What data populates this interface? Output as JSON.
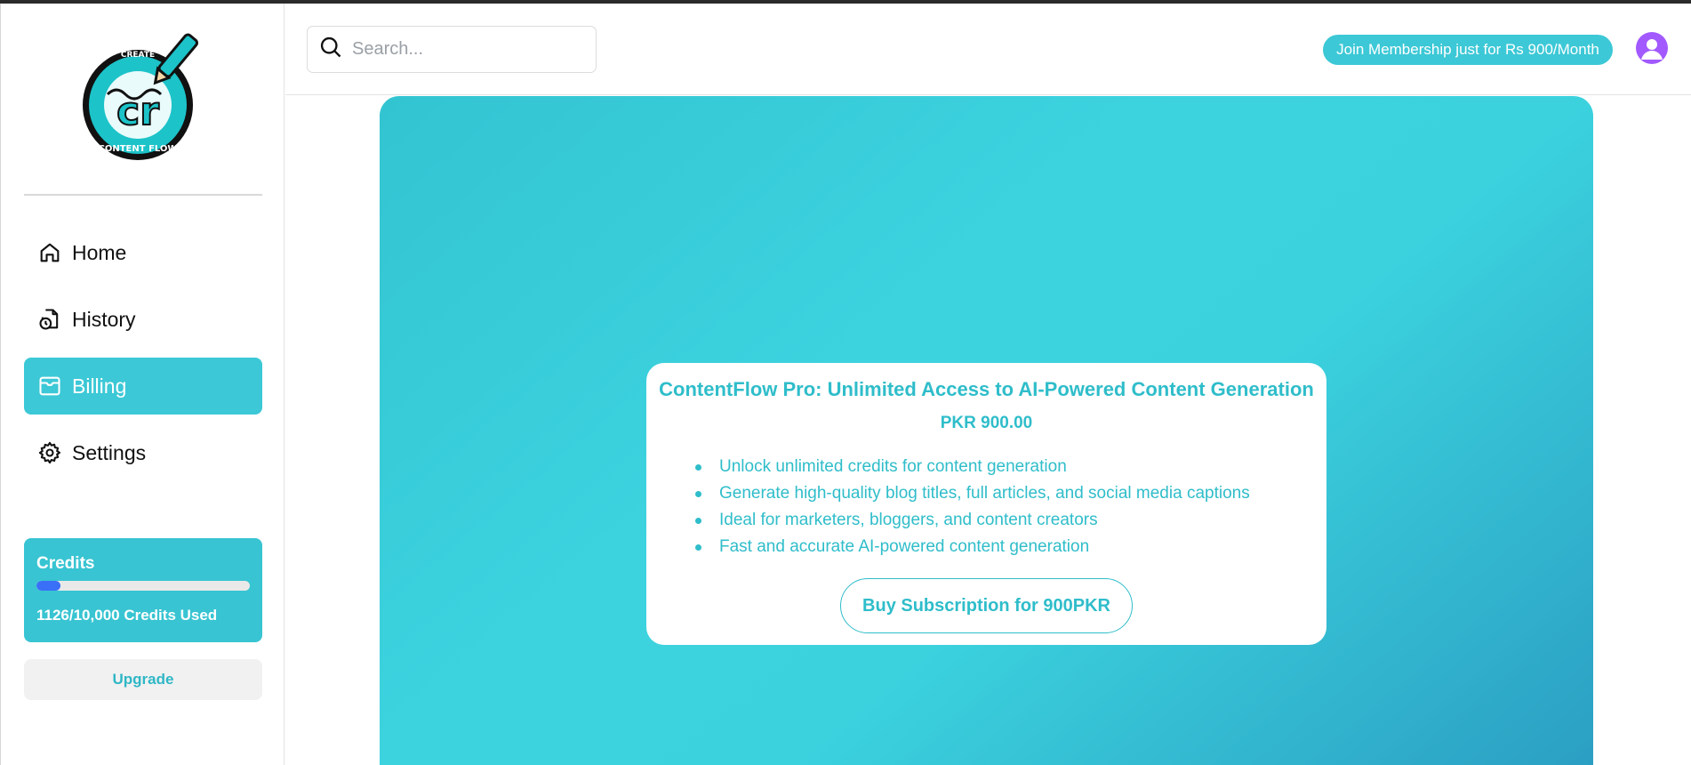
{
  "app": {
    "name": "ContentFlow",
    "logo_text_top": "CREATE",
    "logo_text_bottom": "CONTENT FLOW",
    "logo_monogram": "cr"
  },
  "sidebar": {
    "items": [
      {
        "label": "Home",
        "icon": "home-icon",
        "active": false
      },
      {
        "label": "History",
        "icon": "history-icon",
        "active": false
      },
      {
        "label": "Billing",
        "icon": "billing-icon",
        "active": true
      },
      {
        "label": "Settings",
        "icon": "gear-icon",
        "active": false
      }
    ],
    "credits": {
      "title": "Credits",
      "used": 1126,
      "total": 10000,
      "fraction_used": 0.1126,
      "text": "1126/10,000 Credits Used"
    },
    "upgrade_label": "Upgrade"
  },
  "header": {
    "search_placeholder": "Search...",
    "membership_label": "Join Membership just for Rs 900/Month"
  },
  "plan": {
    "title": "ContentFlow Pro: Unlimited Access to AI-Powered Content Generation",
    "price": "PKR 900.00",
    "features": [
      "Unlock unlimited credits for content generation",
      "Generate high-quality blog titles, full articles, and social media captions",
      "Ideal for marketers, bloggers, and content creators",
      "Fast and accurate AI-powered content generation"
    ],
    "buy_label": "Buy Subscription for 900PKR"
  },
  "colors": {
    "accent": "#3cc8d6",
    "progress": "#3a6ff7",
    "avatar": "#a259ff"
  }
}
